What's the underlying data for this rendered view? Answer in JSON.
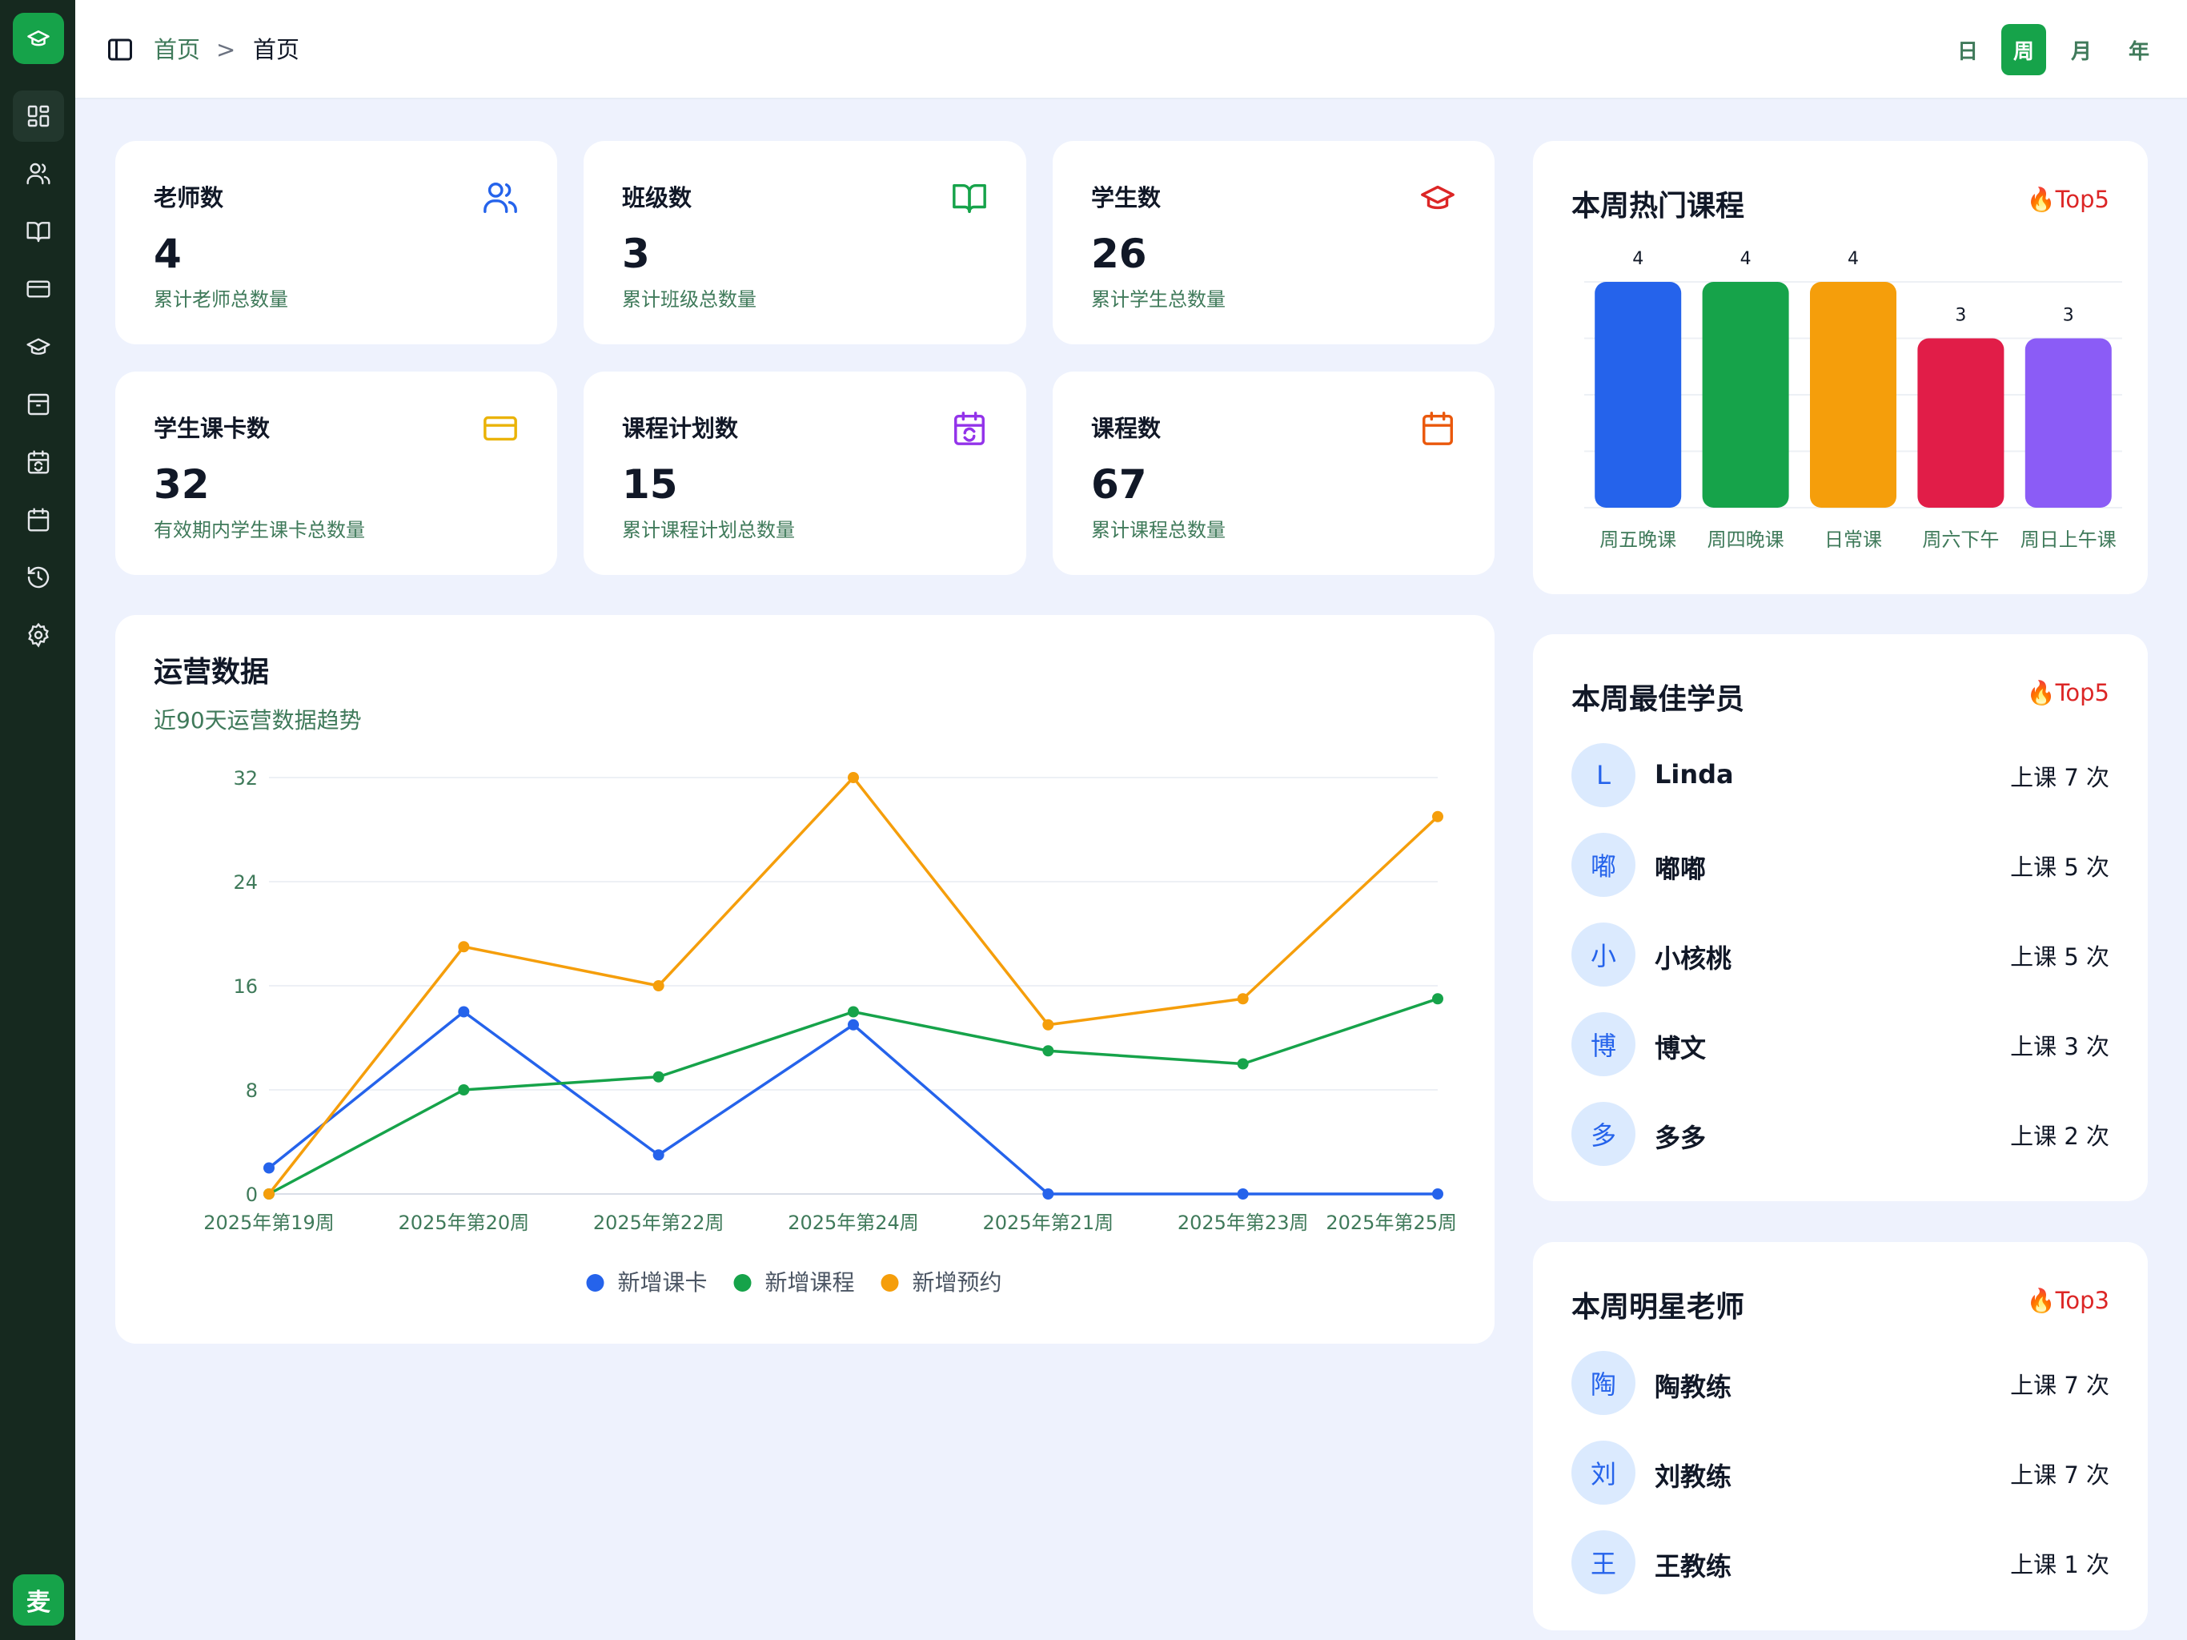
{
  "app": {
    "logo_icon": "graduation-cap-icon",
    "user_avatar": "麦",
    "accent": "#16a34a",
    "sidebar_bg": "#16291f"
  },
  "sidebar": {
    "items": [
      {
        "icon": "dashboard-icon",
        "active": true
      },
      {
        "icon": "users-icon"
      },
      {
        "icon": "book-open-icon"
      },
      {
        "icon": "credit-card-icon"
      },
      {
        "icon": "graduation-cap-icon"
      },
      {
        "icon": "archive-icon"
      },
      {
        "icon": "calendar-sync-icon"
      },
      {
        "icon": "calendar-icon"
      },
      {
        "icon": "history-icon"
      },
      {
        "icon": "gear-icon"
      }
    ]
  },
  "header": {
    "breadcrumb_root": "首页",
    "breadcrumb_separator": ">",
    "breadcrumb_current": "首页",
    "periods": [
      "日",
      "周",
      "月",
      "年"
    ],
    "active_period": "周"
  },
  "stats": [
    {
      "title": "老师数",
      "value": "4",
      "desc": "累计老师总数量",
      "icon": "users-icon",
      "color": "#2563eb"
    },
    {
      "title": "班级数",
      "value": "3",
      "desc": "累计班级总数量",
      "icon": "book-open-icon",
      "color": "#16a34a"
    },
    {
      "title": "学生数",
      "value": "26",
      "desc": "累计学生总数量",
      "icon": "graduation-cap-icon",
      "color": "#dc2626"
    },
    {
      "title": "学生课卡数",
      "value": "32",
      "desc": "有效期内学生课卡总数量",
      "icon": "credit-card-icon",
      "color": "#eab308"
    },
    {
      "title": "课程计划数",
      "value": "15",
      "desc": "累计课程计划总数量",
      "icon": "calendar-sync-icon",
      "color": "#9333ea"
    },
    {
      "title": "课程数",
      "value": "67",
      "desc": "累计课程总数量",
      "icon": "calendar-icon",
      "color": "#ea580c"
    }
  ],
  "operations": {
    "title": "运营数据",
    "subtitle": "近90天运营数据趋势"
  },
  "hot_courses": {
    "title": "本周热门课程",
    "badge": "🔥Top5"
  },
  "best_students": {
    "title": "本周最佳学员",
    "badge": "🔥Top5",
    "items": [
      {
        "avatar": "L",
        "name": "Linda",
        "count": "上课 7 次"
      },
      {
        "avatar": "嘟",
        "name": "嘟嘟",
        "count": "上课 5 次"
      },
      {
        "avatar": "小",
        "name": "小核桃",
        "count": "上课 5 次"
      },
      {
        "avatar": "博",
        "name": "博文",
        "count": "上课 3 次"
      },
      {
        "avatar": "多",
        "name": "多多",
        "count": "上课 2 次"
      }
    ]
  },
  "star_teachers": {
    "title": "本周明星老师",
    "badge": "🔥Top3",
    "items": [
      {
        "avatar": "陶",
        "name": "陶教练",
        "count": "上课 7 次"
      },
      {
        "avatar": "刘",
        "name": "刘教练",
        "count": "上课 7 次"
      },
      {
        "avatar": "王",
        "name": "王教练",
        "count": "上课 1 次"
      }
    ]
  },
  "chart_data": [
    {
      "type": "line",
      "title": "运营数据",
      "subtitle": "近90天运营数据趋势",
      "categories": [
        "2025年第19周",
        "2025年第20周",
        "2025年第22周",
        "2025年第24周",
        "2025年第21周",
        "2025年第23周",
        "2025年第25周"
      ],
      "series": [
        {
          "name": "新增课卡",
          "color": "#2563eb",
          "values": [
            2,
            14,
            3,
            13,
            0,
            0,
            0
          ]
        },
        {
          "name": "新增课程",
          "color": "#16a34a",
          "values": [
            0,
            8,
            9,
            14,
            11,
            10,
            15
          ]
        },
        {
          "name": "新增预约",
          "color": "#f59e0b",
          "values": [
            0,
            19,
            16,
            32,
            13,
            15,
            29
          ]
        }
      ],
      "y_ticks": [
        0,
        8,
        16,
        24,
        32
      ],
      "ylim": [
        0,
        32
      ],
      "grid": true,
      "legend": "bottom"
    },
    {
      "type": "bar",
      "title": "本周热门课程",
      "categories": [
        "周五晚课",
        "周四晚课",
        "日常课",
        "周六下午",
        "周日上午课"
      ],
      "values": [
        4,
        4,
        4,
        3,
        3
      ],
      "colors": [
        "#2563eb",
        "#16a34a",
        "#f59e0b",
        "#e11d48",
        "#8b5cf6"
      ],
      "ylim": [
        0,
        4
      ],
      "grid": true
    }
  ]
}
